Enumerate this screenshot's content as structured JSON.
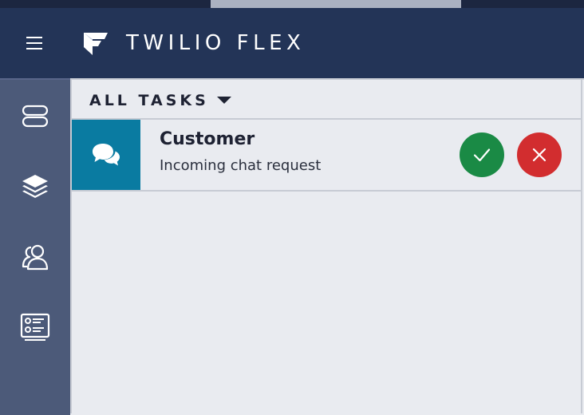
{
  "app": {
    "brand_name": "TWILIO FLEX"
  },
  "sidebar": {
    "items": [
      {
        "name": "agent-desktop",
        "icon": "server-icon"
      },
      {
        "name": "teams",
        "icon": "layers-icon"
      },
      {
        "name": "queues",
        "icon": "users-icon"
      },
      {
        "name": "insights",
        "icon": "list-card-icon"
      }
    ]
  },
  "tasks": {
    "filter_label": "ALL TASKS",
    "items": [
      {
        "title": "Customer",
        "subtitle": "Incoming chat request",
        "channel_icon": "chat-bubbles-icon",
        "accept_icon": "check-icon",
        "reject_icon": "close-icon"
      }
    ]
  },
  "colors": {
    "header_bg": "#233457",
    "sidebar_bg": "#4c5a79",
    "channel_bg": "#0a7ba1",
    "accept": "#1a8a45",
    "reject": "#d22d2f"
  }
}
